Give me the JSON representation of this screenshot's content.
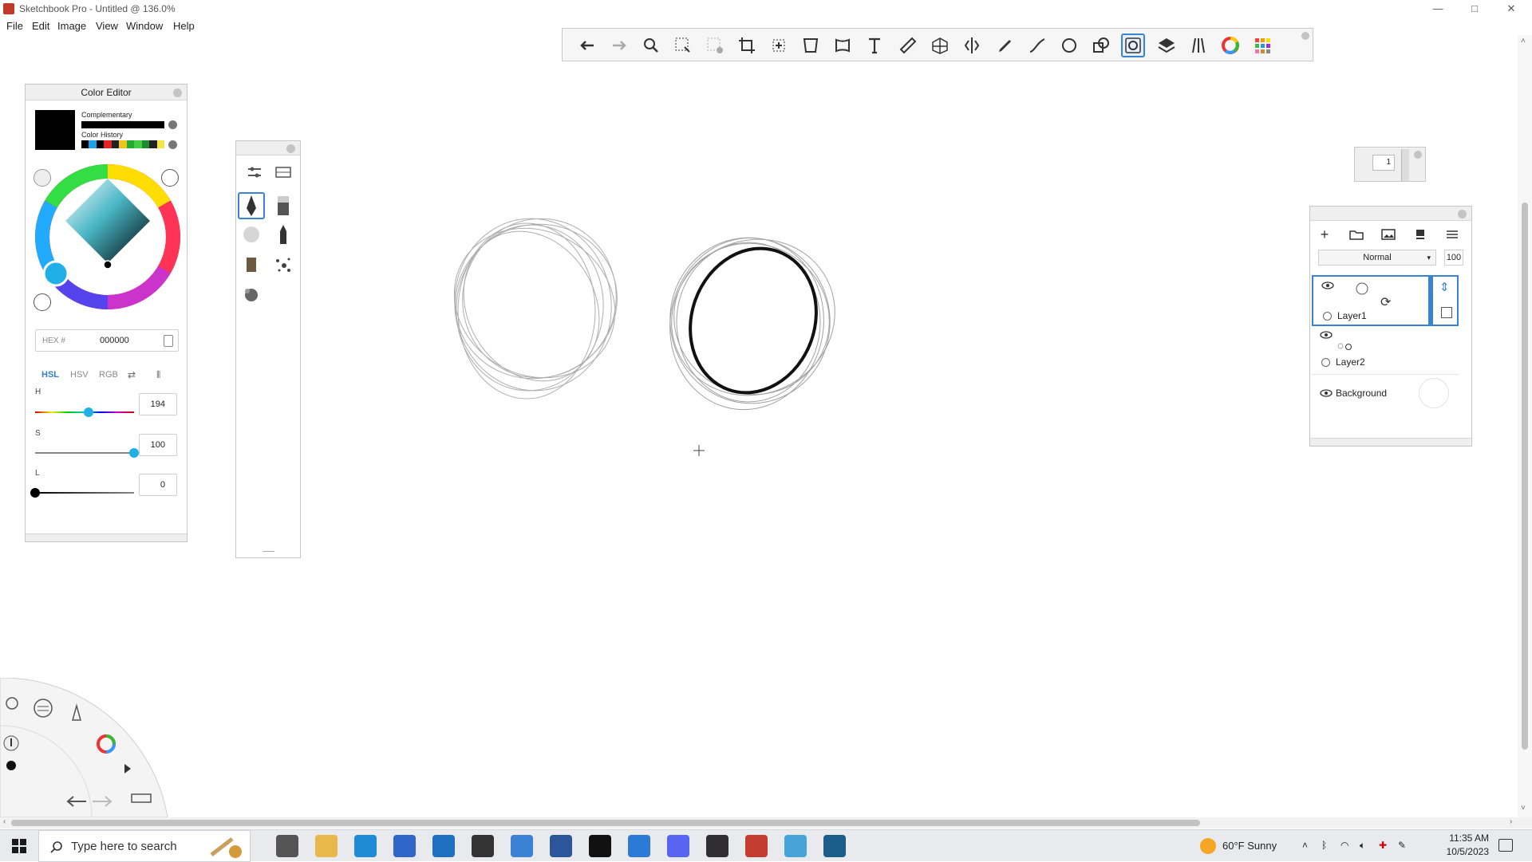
{
  "window": {
    "title": "Sketchbook Pro - Untitled @ 136.0%",
    "controls": [
      "—",
      "□",
      "✕"
    ]
  },
  "menu": [
    "File",
    "Edit",
    "Image",
    "View",
    "Window",
    "Help"
  ],
  "toolbar": {
    "tools": [
      "undo-icon",
      "redo-icon",
      "zoom-icon",
      "select-icon",
      "clear-select-icon",
      "crop-icon",
      "transform-icon",
      "distort-icon",
      "warp-icon",
      "text-icon",
      "ruler-icon",
      "perspective-icon",
      "symmetry-icon",
      "pencil-line-icon",
      "curve-icon",
      "ellipse-icon",
      "shapes-icon",
      "predictive-stroke-icon",
      "layers-icon",
      "brush-library-icon",
      "color-wheel-icon",
      "copic-icon"
    ],
    "active_tool": "predictive-stroke-icon"
  },
  "color_editor": {
    "title": "Color Editor",
    "complementary_label": "Complementary",
    "history_label": "Color History",
    "history_colors": [
      "#000000",
      "#1aa3e8",
      "#000000",
      "#e52222",
      "#222222",
      "#f0c419",
      "#22aa33",
      "#44cc44",
      "#1d8a2c",
      "#222222",
      "#f5e642"
    ],
    "current_color": "#000000",
    "hex_label": "HEX #",
    "hex_value": "000000",
    "modes": [
      "HSL",
      "HSV",
      "RGB"
    ],
    "active_mode": "HSL",
    "sliders": [
      {
        "label": "H",
        "value": "194",
        "fraction": 0.54
      },
      {
        "label": "S",
        "value": "100",
        "fraction": 1.0
      },
      {
        "label": "L",
        "value": "0",
        "fraction": 0.0
      }
    ]
  },
  "zoom_widget": {
    "value": "1"
  },
  "layers": {
    "blend_mode": "Normal",
    "opacity": "100",
    "items": [
      {
        "name": "Layer1",
        "selected": true
      },
      {
        "name": "Layer2",
        "selected": false
      },
      {
        "name": "Background",
        "selected": false
      }
    ]
  },
  "taskbar": {
    "search_placeholder": "Type here to search",
    "weather": "60°F  Sunny",
    "time": "11:35 AM",
    "date": "10/5/2023",
    "apps": [
      {
        "name": "task-view-icon",
        "color": "#555555"
      },
      {
        "name": "file-explorer-icon",
        "color": "#e8b84a"
      },
      {
        "name": "edge-icon",
        "color": "#1f8ad6"
      },
      {
        "name": "edge-dev-icon",
        "color": "#3066c7"
      },
      {
        "name": "mail-icon",
        "color": "#1f6fc0"
      },
      {
        "name": "unity-icon",
        "color": "#333333"
      },
      {
        "name": "store-icon",
        "color": "#3c82d4"
      },
      {
        "name": "word-icon",
        "color": "#2b579a"
      },
      {
        "name": "tiktok-icon",
        "color": "#111111"
      },
      {
        "name": "cc-icon",
        "color": "#2a7ad6"
      },
      {
        "name": "discord-icon",
        "color": "#5865f2"
      },
      {
        "name": "obs-icon",
        "color": "#302e31"
      },
      {
        "name": "sketchbook-icon",
        "color": "#c43b2f"
      },
      {
        "name": "notepad-icon",
        "color": "#47a4d8"
      },
      {
        "name": "terminal-icon",
        "color": "#1a5c8a"
      }
    ]
  }
}
